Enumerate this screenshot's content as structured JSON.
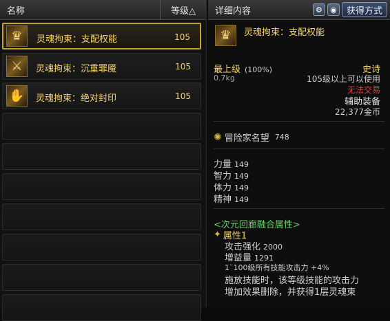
{
  "list": {
    "header_name": "名称",
    "header_level": "等级△",
    "items": [
      {
        "name": "灵魂拘束：支配权能",
        "level": "105",
        "icon": "crown-gauntlet-icon"
      },
      {
        "name": "灵魂拘束：沉重罪魇",
        "level": "105",
        "icon": "chain-gauntlet-icon"
      },
      {
        "name": "灵魂拘束：绝对封印",
        "level": "105",
        "icon": "seal-gauntlet-icon"
      }
    ]
  },
  "detail": {
    "header_title": "详细内容",
    "source_button": "获得方式",
    "item_name": "灵魂拘束：支配权能",
    "top_level": "最上级",
    "top_level_pct": "(100%)",
    "rarity": "史诗",
    "weight": "0.7kg",
    "level_req": "105级以上可以使用",
    "trade": "无法交易",
    "category": "辅助装备",
    "price": "22,377金币",
    "fame_label": "冒险家名望",
    "fame_value": "748",
    "stats": [
      {
        "label": "力量",
        "value": "149"
      },
      {
        "label": "智力",
        "value": "149"
      },
      {
        "label": "体力",
        "value": "149"
      },
      {
        "label": "精神",
        "value": "149"
      }
    ],
    "fusion_title": "<次元回廊融合属性>",
    "attr_title": "属性1",
    "attack_boost_label": "攻击强化",
    "attack_boost_value": "2000",
    "gain_label": "增益量",
    "gain_value": "1291",
    "skill_line": "1`100级所有技能攻击力 +4%",
    "effect_line1": "施放技能时，该等级技能的攻击力",
    "effect_line2": "增加效果删除，并获得1层灵魂束"
  },
  "colors": {
    "gold": "#f5d36c",
    "red": "#e23c3c",
    "green": "#6fd06f"
  }
}
